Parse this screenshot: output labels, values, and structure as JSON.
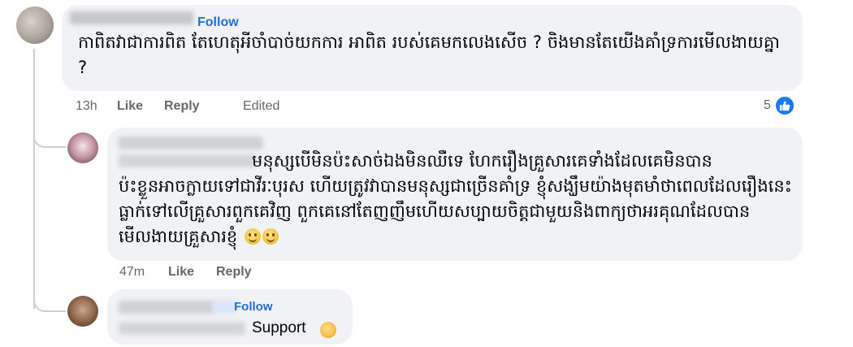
{
  "comment1": {
    "follow_label": "Follow",
    "text": "កាពិតវាជាការពិត តែហេតុអីចាំបាច់យកការ អាពិត របស់គេមកលេងសើច ? ចិងមានតែយើងគាំទ្រការមើលងាយគ្នា ?",
    "actions": {
      "time": "13h",
      "like": "Like",
      "reply": "Reply",
      "edited": "Edited"
    },
    "reaction_count": "5",
    "reaction_icon": "like-icon"
  },
  "comment2": {
    "text_first_line": "មនុស្សបើមិនប៉ះសាច់ឯងមិនឈឺទេ ហែករឿងគ្រួសារគេទាំងដែលគេមិនបាន",
    "text_rest": "ប៉ះខ្លួនអាចក្លាយទៅជាវីរៈបុរស ហើយត្រូវវាបានមនុស្សជាច្រើនគាំទ្រ ខ្ញុំសង្ឃឹមយ៉ាងមុតមាំថាពេលដែលរឿងនេះធ្លាក់ទៅលើគ្រួសារពួកគេវិញ ពួកគេនៅតែញញឹមហើយសប្បាយចិត្តជាមួយនិងពាក្យថាអរគុណដែលបានមើលងាយគ្រួសារខ្ញុំ",
    "emoji": [
      "slightly-smiling-face",
      "slightly-smiling-face"
    ],
    "actions": {
      "time": "47m",
      "like": "Like",
      "reply": "Reply"
    }
  },
  "comment3": {
    "follow_label": "Follow",
    "text": "Support",
    "emoji": "clapping-hands"
  },
  "colors": {
    "bubble": "#f0f2f5",
    "link_blue": "#216fdb",
    "meta_gray": "#65676b",
    "like_blue": "#1877f2"
  }
}
